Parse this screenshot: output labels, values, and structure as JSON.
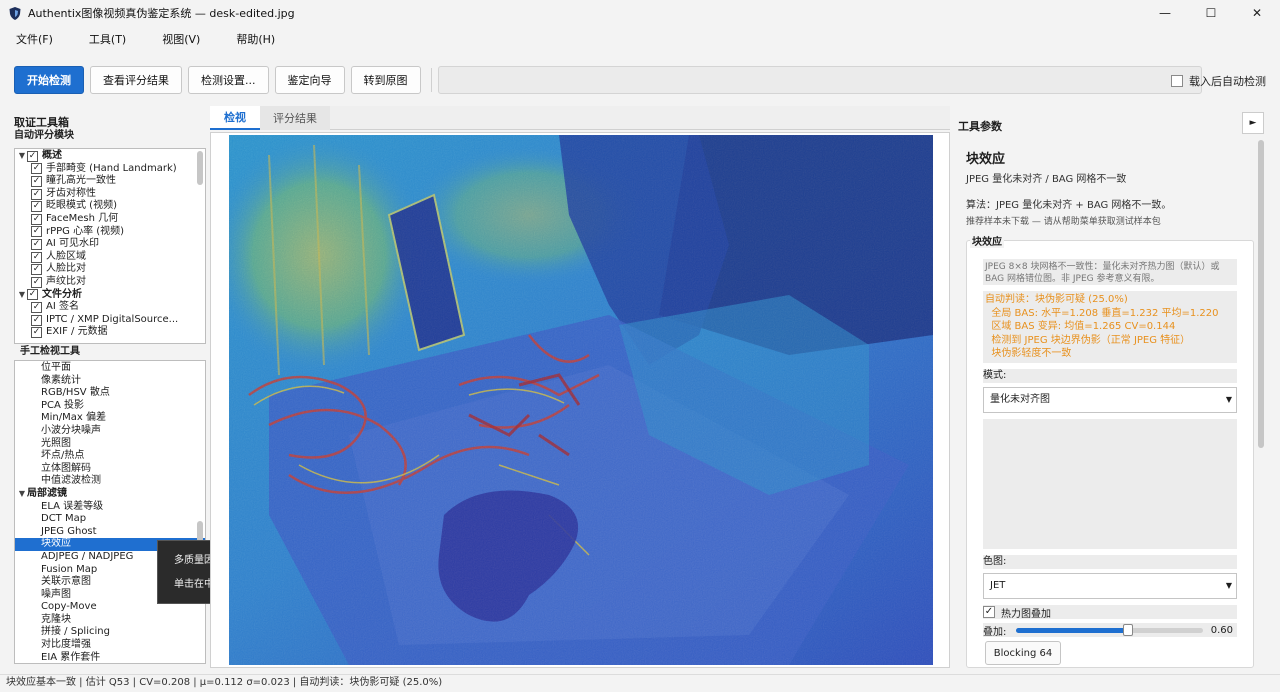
{
  "window": {
    "title": "Authentix图像视频真伪鉴定系统 — desk-edited.jpg",
    "minimize": "—",
    "maximize": "☐",
    "close": "✕"
  },
  "menu": [
    "文件(F)",
    "工具(T)",
    "视图(V)",
    "帮助(H)"
  ],
  "toolbar": {
    "start": "开始检测",
    "view_results": "查看评分结果",
    "settings": "检测设置...",
    "wizard": "鉴定向导",
    "to_original": "转到原图",
    "auto_detect": "载入后自动检测"
  },
  "left": {
    "title": "取证工具箱",
    "auto_section": "自动评分模块",
    "manual_section": "手工检视工具",
    "auto_tree": [
      {
        "label": "概述",
        "level": 0,
        "arrow": "▼",
        "checked": true,
        "bold": true
      },
      {
        "label": "手部畸变 (Hand Landmark)",
        "level": 1,
        "checked": true
      },
      {
        "label": "瞳孔高光一致性",
        "level": 1,
        "checked": true
      },
      {
        "label": "牙齿对称性",
        "level": 1,
        "checked": true
      },
      {
        "label": "眨眼模式 (视频)",
        "level": 1,
        "checked": true
      },
      {
        "label": "FaceMesh 几何",
        "level": 1,
        "checked": true
      },
      {
        "label": "rPPG 心率 (视频)",
        "level": 1,
        "checked": true
      },
      {
        "label": "AI 可见水印",
        "level": 1,
        "checked": true
      },
      {
        "label": "人脸区域",
        "level": 1,
        "checked": true
      },
      {
        "label": "人脸比对",
        "level": 1,
        "checked": true
      },
      {
        "label": "声纹比对",
        "level": 1,
        "checked": true
      },
      {
        "label": "文件分析",
        "level": 0,
        "arrow": "▼",
        "checked": true,
        "bold": true
      },
      {
        "label": "AI 签名",
        "level": 1,
        "checked": true
      },
      {
        "label": "IPTC / XMP DigitalSource...",
        "level": 1,
        "checked": true
      },
      {
        "label": "EXIF / 元数据",
        "level": 1,
        "checked": true
      }
    ],
    "manual_tree": [
      {
        "label": "位平面",
        "level": 1
      },
      {
        "label": "像素统计",
        "level": 1
      },
      {
        "label": "RGB/HSV 散点",
        "level": 1
      },
      {
        "label": "PCA 投影",
        "level": 1
      },
      {
        "label": "Min/Max 偏差",
        "level": 1
      },
      {
        "label": "小波分块噪声",
        "level": 1
      },
      {
        "label": "光照图",
        "level": 1
      },
      {
        "label": "坏点/热点",
        "level": 1
      },
      {
        "label": "立体图解码",
        "level": 1
      },
      {
        "label": "中值滤波检测",
        "level": 1
      },
      {
        "label": "局部滤镜",
        "level": 0,
        "arrow": "▼",
        "bold": true
      },
      {
        "label": "ELA 误差等级",
        "level": 1
      },
      {
        "label": "DCT Map",
        "level": 1
      },
      {
        "label": "JPEG Ghost",
        "level": 1
      },
      {
        "label": "块效应",
        "level": 1,
        "selected": true
      },
      {
        "label": "ADJPEG / NADJPEG",
        "level": 1
      },
      {
        "label": "Fusion Map",
        "level": 1
      },
      {
        "label": "关联示意图",
        "level": 1
      },
      {
        "label": "噪声图",
        "level": 1
      },
      {
        "label": "Copy-Move",
        "level": 1
      },
      {
        "label": "克隆块",
        "level": 1
      },
      {
        "label": "拼接 / Splicing",
        "level": 1
      },
      {
        "label": "对比度增强",
        "level": 1
      },
      {
        "label": "EIA 累作套件",
        "level": 1
      }
    ],
    "tooltip": [
      "多质量因子 Ghost 图",
      "单击在中央视图打开"
    ]
  },
  "center": {
    "tabs": [
      "检视",
      "评分结果"
    ]
  },
  "right": {
    "title": "工具参数",
    "collapse": "►",
    "heading": "块效应",
    "desc": "JPEG 量化未对齐 / BAG 网格不一致",
    "algo": "算法：JPEG 量化未对齐 + BAG 网格不一致。",
    "hint": "推荐样本未下载 — 请从帮助菜单获取测试样本包",
    "group_title": "块效应",
    "info": "JPEG 8×8 块网格不一致性：量化未对齐热力图（默认）或 BAG 网格错位图。非 JPEG 参考意义有限。",
    "result_lines": [
      "自动判读：块伪影可疑 (25.0%)",
      "  全局 BAS: 水平=1.208 垂直=1.232 平均=1.220",
      "  区域 BAS 变异: 均值=1.265 CV=0.144",
      "  检测到 JPEG 块边界伪影（正常 JPEG 特征）",
      "  块伪影轻度不一致"
    ],
    "mode_label": "模式:",
    "mode_value": "量化未对齐图",
    "colormap_label": "色图:",
    "colormap_value": "JET",
    "overlay_check": "热力图叠加",
    "overlay_label": "叠加:",
    "overlay_value": "0.60",
    "overlay_fraction": 0.6,
    "button": "Blocking 64"
  },
  "status": "块效应基本一致 | 估计 Q53 | CV=0.208 | μ=0.112 σ=0.023 | 自动判读：块伪影可疑 (25.0%)"
}
